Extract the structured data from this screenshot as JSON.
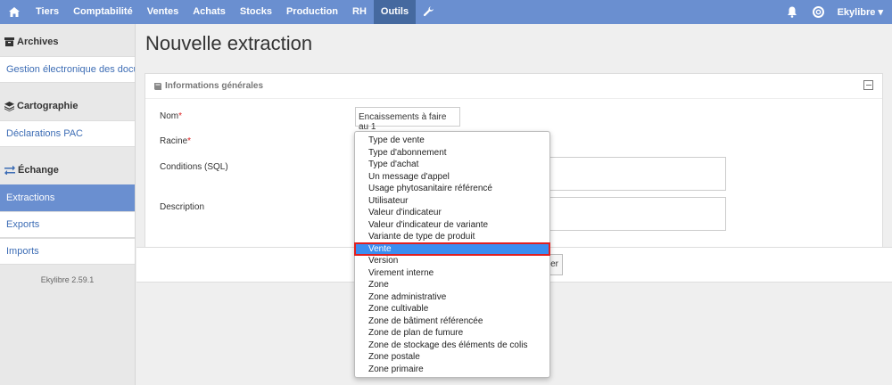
{
  "nav": {
    "home_icon": "home-icon",
    "items": [
      {
        "label": "Tiers"
      },
      {
        "label": "Comptabilité"
      },
      {
        "label": "Ventes"
      },
      {
        "label": "Achats"
      },
      {
        "label": "Stocks"
      },
      {
        "label": "Production"
      },
      {
        "label": "RH"
      },
      {
        "label": "Outils"
      }
    ],
    "active_item": "Outils",
    "tools_icon": "wrench-icon",
    "notifications_icon": "bell-icon",
    "help_icon": "lifebuoy-icon",
    "user_label": "Ekylibre",
    "user_caret": "▾"
  },
  "sidebar": {
    "sections": [
      {
        "title": "Archives",
        "icon": "archive-icon",
        "links": [
          "Gestion électronique des docu..."
        ]
      },
      {
        "title": "Cartographie",
        "icon": "layers-icon",
        "links": [
          "Déclarations PAC"
        ]
      },
      {
        "title": "Échange",
        "icon": "exchange-icon",
        "links": [
          "Extractions",
          "Exports",
          "Imports"
        ]
      }
    ],
    "active_link": "Extractions",
    "version": "Ekylibre 2.59.1"
  },
  "main": {
    "title": "Nouvelle extraction",
    "panel_title": "Informations générales",
    "labels": {
      "nom": "Nom",
      "racine": "Racine",
      "conditions": "Conditions (SQL)",
      "description": "Description",
      "required_mark": "*"
    },
    "nom_value": "Encaissements à faire au 1",
    "create_button_partial": "er"
  },
  "dropdown": {
    "options": [
      "Type de vente",
      "Type d'abonnement",
      "Type d'achat",
      "Un message d'appel",
      "Usage phytosanitaire référencé",
      "Utilisateur",
      "Valeur d'indicateur",
      "Valeur d'indicateur de variante",
      "Variante de type de produit",
      "Vente",
      "Version",
      "Virement interne",
      "Zone",
      "Zone administrative",
      "Zone cultivable",
      "Zone de bâtiment référencée",
      "Zone de plan de fumure",
      "Zone de stockage des éléments de colis",
      "Zone postale",
      "Zone primaire"
    ],
    "selected": "Vente"
  },
  "colors": {
    "topbar": "#6a8fd0",
    "topbar_active": "#45699f",
    "link": "#3d6db5",
    "selection": "#3b8df0",
    "highlight_border": "#e02020"
  }
}
